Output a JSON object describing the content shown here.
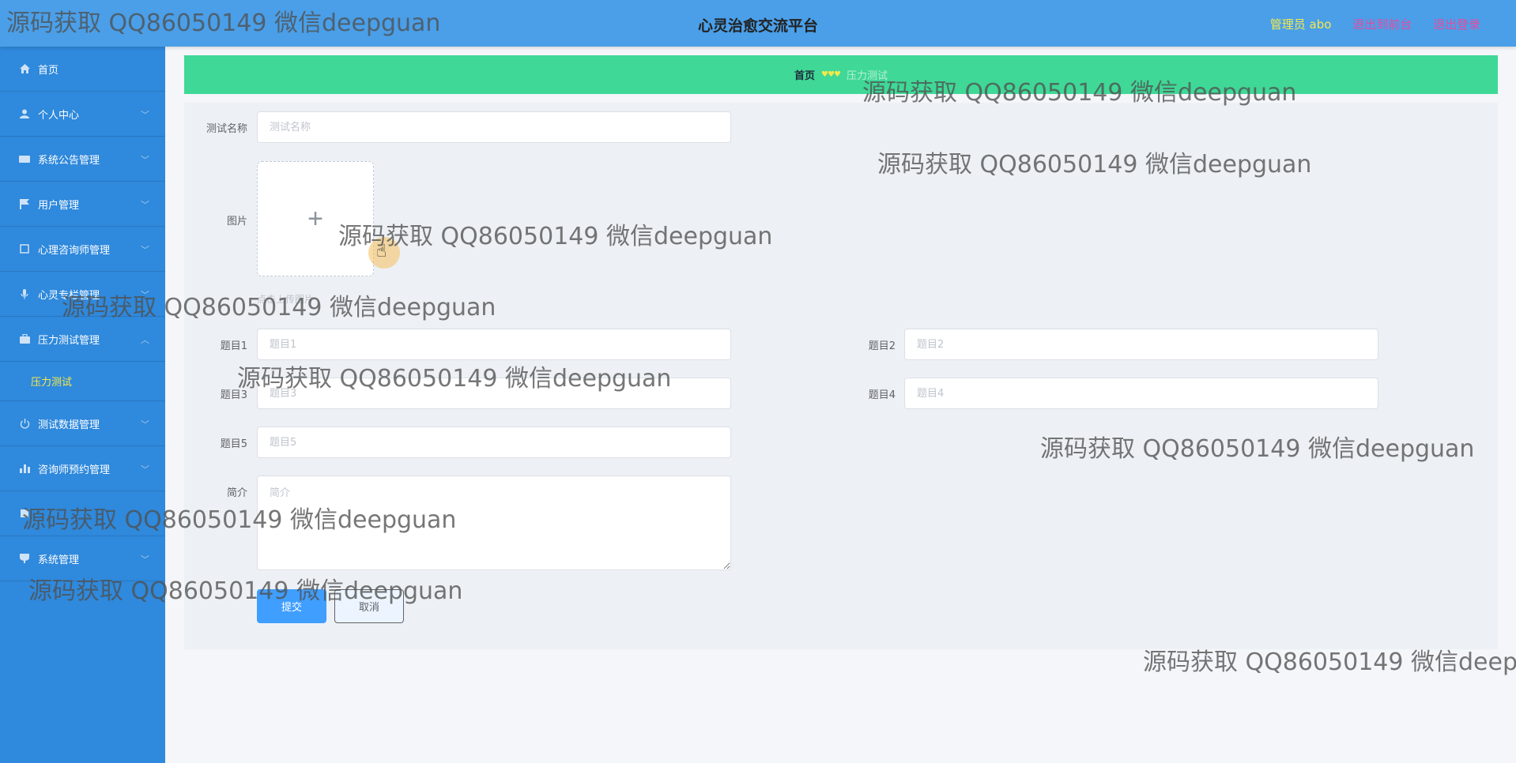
{
  "header": {
    "title": "心灵治愈交流平台",
    "admin_label": "管理员 abo",
    "back_to_front": "退出到前台",
    "logout": "退出登录"
  },
  "sidebar": {
    "items": [
      {
        "label": "首页",
        "icon": "home-icon"
      },
      {
        "label": "个人中心",
        "icon": "user-icon"
      },
      {
        "label": "系统公告管理",
        "icon": "announcement-icon"
      },
      {
        "label": "用户管理",
        "icon": "flag-icon"
      },
      {
        "label": "心理咨询师管理",
        "icon": "square-icon"
      },
      {
        "label": "心灵专栏管理",
        "icon": "mic-icon"
      },
      {
        "label": "压力测试管理",
        "icon": "briefcase-icon"
      },
      {
        "label": "测试数据管理",
        "icon": "power-icon"
      },
      {
        "label": "咨询师预约管理",
        "icon": "bar-chart-icon"
      },
      {
        "label": "系统管理",
        "icon": "cup-icon"
      }
    ],
    "active_sub": "压力测试"
  },
  "breadcrumb": {
    "home": "首页",
    "separator": "♥♥♥",
    "current": "压力测试"
  },
  "form": {
    "name_label": "测试名称",
    "name_placeholder": "测试名称",
    "image_label": "图片",
    "upload_tip": "点击上传图片",
    "q1_label": "题目1",
    "q1_placeholder": "题目1",
    "q2_label": "题目2",
    "q2_placeholder": "题目2",
    "q3_label": "题目3",
    "q3_placeholder": "题目3",
    "q4_label": "题目4",
    "q4_placeholder": "题目4",
    "q5_label": "题目5",
    "q5_placeholder": "题目5",
    "intro_label": "简介",
    "intro_placeholder": "简介",
    "submit": "提交",
    "cancel": "取消"
  },
  "watermark": "源码获取 QQ86050149 微信deepguan",
  "colors": {
    "header": "#4a9fe8",
    "sidebar": "#2f89dc",
    "breadcrumb": "#3fd897",
    "accent_yellow": "#f5e94a",
    "link_pink": "#e84aa0",
    "primary": "#409eff"
  }
}
